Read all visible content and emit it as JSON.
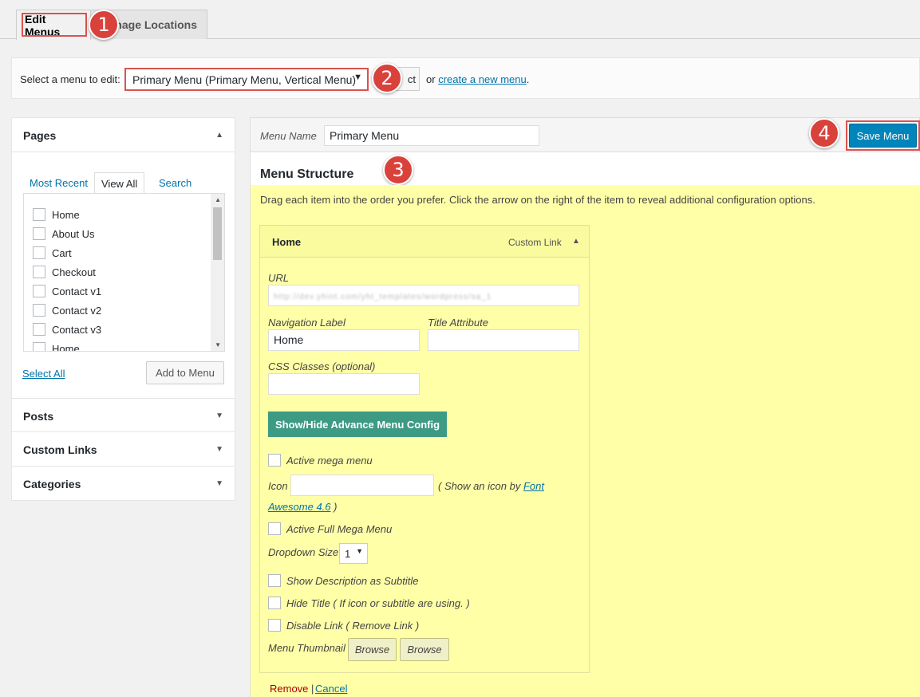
{
  "tabs": {
    "edit_menus": "Edit Menus",
    "manage_locations": "Manage Locations",
    "manage_locations_visible": "nage Locations"
  },
  "annotations": [
    "1",
    "2",
    "3",
    "4"
  ],
  "select_bar": {
    "label": "Select a menu to edit:",
    "selected_menu": "Primary Menu (Primary Menu, Vertical Menu)",
    "select_button_visible": "ct",
    "or_text": "or",
    "create_link": "create a new menu",
    "period": "."
  },
  "sidebar": {
    "pages_title": "Pages",
    "page_tabs": [
      "Most Recent",
      "View All",
      "Search"
    ],
    "pages": [
      "Home",
      "About Us",
      "Cart",
      "Checkout",
      "Contact v1",
      "Contact v2",
      "Contact v3",
      "Home"
    ],
    "select_all": "Select All",
    "add_to_menu": "Add to Menu",
    "sections": [
      "Posts",
      "Custom Links",
      "Categories"
    ]
  },
  "menu_header": {
    "menu_name_label": "Menu Name",
    "menu_name_value": "Primary Menu",
    "save_button": "Save Menu"
  },
  "structure": {
    "title": "Menu Structure",
    "instructions": "Drag each item into the order you prefer. Click the arrow on the right of the item to reveal additional configuration options."
  },
  "item": {
    "title": "Home",
    "type": "Custom Link",
    "url_label": "URL",
    "url_value": "http://dev.yhint.com/yht_templates/wordpress/sa_1",
    "nav_label_label": "Navigation Label",
    "nav_label_value": "Home",
    "title_attr_label": "Title Attribute",
    "css_classes_label": "CSS Classes (optional)",
    "advance_button": "Show/Hide Advance Menu Config",
    "active_mega": "Active mega menu",
    "icon_label": "Icon",
    "icon_hint_pre": "( Show an icon by",
    "icon_link_1": "Font",
    "icon_link_2": "Awesome 4.6",
    "icon_hint_post": ")",
    "active_full_mega": "Active Full Mega Menu",
    "dropdown_size_label": "Dropdown Size",
    "dropdown_size_value": "1",
    "show_desc": "Show Description as Subtitle",
    "hide_title": "Hide Title ( If icon or subtitle are using. )",
    "disable_link": "Disable Link ( Remove Link )",
    "thumbnail_label": "Menu Thumbnail",
    "browse_1": "Browse",
    "browse_2": "Browse",
    "remove": "Remove",
    "separator": "|",
    "cancel": "Cancel"
  },
  "colors": {
    "accent": "#0085ba",
    "highlight": "#d9534f",
    "item_bg": "#ffffa8",
    "green_button": "#3d9a83"
  },
  "icons": {
    "collapse": "triangle-up-icon",
    "expand": "triangle-down-icon",
    "dropdown": "caret-down-icon"
  }
}
